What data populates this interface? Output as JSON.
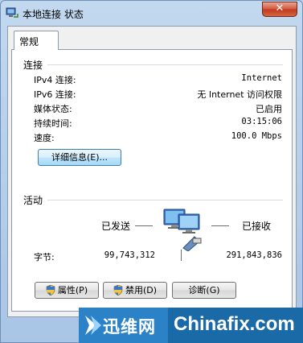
{
  "window": {
    "title": "本地连接 状态",
    "close_label": "✕"
  },
  "tabs": [
    {
      "label": "常规"
    }
  ],
  "connection": {
    "header": "连接",
    "rows": [
      {
        "label": "IPv4 连接:",
        "value": "Internet"
      },
      {
        "label": "IPv6 连接:",
        "value": "无 Internet 访问权限"
      },
      {
        "label": "媒体状态:",
        "value": "已启用"
      },
      {
        "label": "持续时间:",
        "value": "03:15:06"
      },
      {
        "label": "速度:",
        "value": "100.0 Mbps"
      }
    ],
    "details_button": "详细信息(E)..."
  },
  "activity": {
    "header": "活动",
    "sent_label": "已发送",
    "received_label": "已接收",
    "bytes_label": "字节:",
    "bytes_sent": "99,743,312",
    "bytes_received": "291,843,836"
  },
  "buttons": {
    "properties": "属性(P)",
    "disable": "禁用(D)",
    "diagnose": "诊断(G)"
  },
  "watermark": {
    "cn_text": "迅维网",
    "en_text": "Chinafix.com"
  },
  "icons": {
    "title": "network-connection-icon",
    "activity": "network-computers-icon",
    "shield": "uac-shield-icon"
  }
}
